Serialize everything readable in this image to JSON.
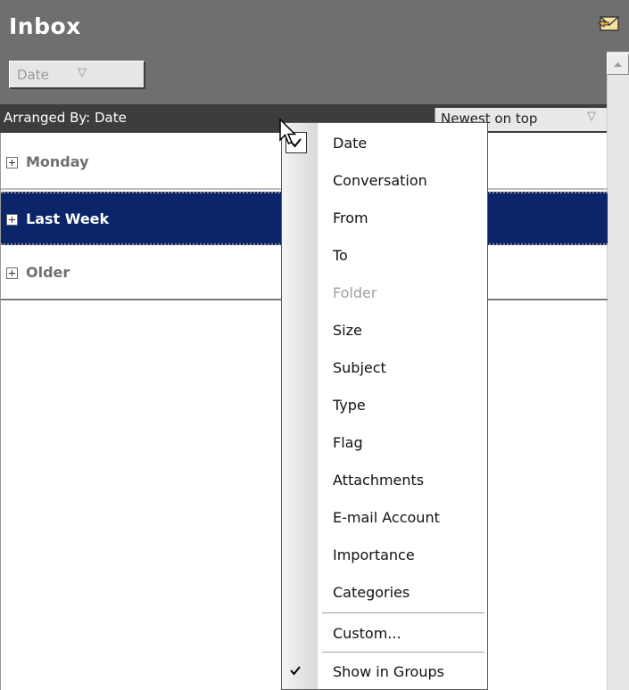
{
  "header": {
    "title": "Inbox",
    "icon": "envelope-icon",
    "filter": {
      "value": "Date",
      "arrow": "▽"
    }
  },
  "arrange_bar": {
    "label": "Arranged By: Date",
    "sort_order": "Newest on top",
    "sort_arrow": "▽"
  },
  "groups": [
    {
      "label": "Monday",
      "selected": false
    },
    {
      "label": "Last Week",
      "selected": true
    },
    {
      "label": "Older",
      "selected": false
    }
  ],
  "menu": {
    "items": [
      {
        "label": "Date",
        "checked": true,
        "enabled": true
      },
      {
        "label": "Conversation",
        "checked": false,
        "enabled": true
      },
      {
        "label": "From",
        "checked": false,
        "enabled": true
      },
      {
        "label": "To",
        "checked": false,
        "enabled": true
      },
      {
        "label": "Folder",
        "checked": false,
        "enabled": false
      },
      {
        "label": "Size",
        "checked": false,
        "enabled": true
      },
      {
        "label": "Subject",
        "checked": false,
        "enabled": true
      },
      {
        "label": "Type",
        "checked": false,
        "enabled": true
      },
      {
        "label": "Flag",
        "checked": false,
        "enabled": true
      },
      {
        "label": "Attachments",
        "checked": false,
        "enabled": true
      },
      {
        "label": "E-mail Account",
        "checked": false,
        "enabled": true
      },
      {
        "label": "Importance",
        "checked": false,
        "enabled": true
      },
      {
        "label": "Categories",
        "checked": false,
        "enabled": true
      },
      {
        "label": "Custom...",
        "checked": false,
        "enabled": true
      },
      {
        "label": "Show in Groups",
        "checked": true,
        "enabled": true
      }
    ]
  },
  "colors": {
    "header_bg": "#6f6f6f",
    "arrange_bar_bg": "#3d3d3d",
    "selection_bg": "#0b246a",
    "disabled_text": "#9f9f9f"
  }
}
